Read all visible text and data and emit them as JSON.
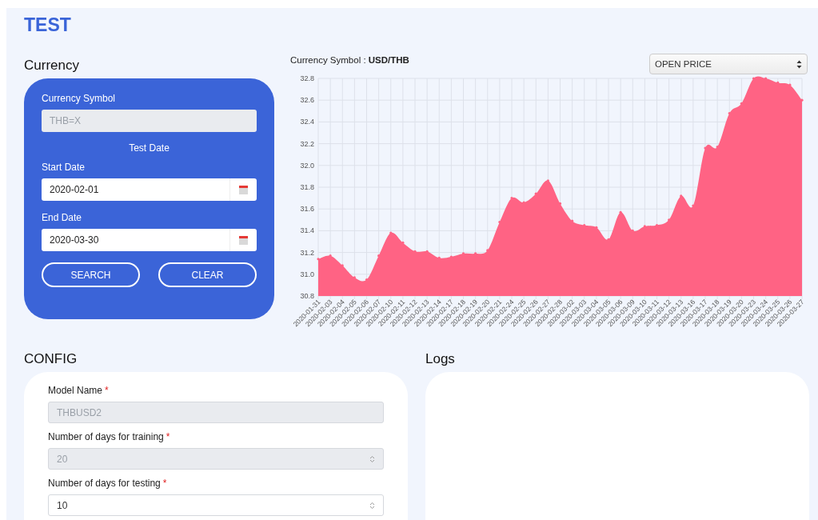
{
  "page_title": "TEST",
  "currency": {
    "heading": "Currency",
    "symbol_label": "Currency Symbol",
    "symbol": {
      "value": "THB=X",
      "disabled": true
    },
    "test_date_label": "Test Date",
    "start_label": "Start Date",
    "start_value": "2020-02-01",
    "end_label": "End Date",
    "end_value": "2020-03-30",
    "buttons": [
      "SEARCH",
      "CLEAR"
    ]
  },
  "chart_panel": {
    "symbol_text": "Currency Symbol : **USD/THB**",
    "chart_data": {
      "type": "area",
      "categories": [
        "2020-01-31",
        "2020-02-03",
        "2020-02-04",
        "2020-02-05",
        "2020-02-06",
        "2020-02-07",
        "2020-02-10",
        "2020-02-11",
        "2020-02-12",
        "2020-02-13",
        "2020-02-14",
        "2020-02-17",
        "2020-02-18",
        "2020-02-19",
        "2020-02-20",
        "2020-02-21",
        "2020-02-24",
        "2020-02-25",
        "2020-02-26",
        "2020-02-27",
        "2020-02-28",
        "2020-03-02",
        "2020-03-03",
        "2020-03-04",
        "2020-03-05",
        "2020-03-06",
        "2020-03-09",
        "2020-03-10",
        "2020-03-11",
        "2020-03-12",
        "2020-03-13",
        "2020-03-16",
        "2020-03-17",
        "2020-03-18",
        "2020-03-19",
        "2020-03-20",
        "2020-03-23",
        "2020-03-24",
        "2020-03-25",
        "2020-03-26",
        "2020-03-27"
      ],
      "grid": true,
      "series": [
        {
          "name": "OPEN PRICE",
          "color": "#ff6384",
          "values": [
            31.14,
            31.17,
            31.08,
            30.97,
            30.95,
            31.17,
            31.38,
            31.29,
            31.21,
            31.21,
            31.15,
            31.16,
            31.19,
            31.19,
            31.22,
            31.48,
            31.7,
            31.66,
            31.74,
            31.86,
            31.65,
            31.49,
            31.45,
            31.43,
            31.32,
            31.57,
            31.4,
            31.44,
            31.45,
            31.5,
            31.72,
            31.63,
            32.16,
            32.17,
            32.48,
            32.57,
            32.8,
            32.8,
            32.76,
            32.74,
            32.6
          ]
        }
      ],
      "ylim": [
        30.8,
        32.8
      ],
      "yticks": [
        {
          "value": 30.8,
          "label": "30.8"
        },
        {
          "value": 31,
          "label": "31.0"
        },
        {
          "value": 31.2,
          "label": "31.2"
        },
        {
          "value": 31.4,
          "label": "31.4"
        },
        {
          "value": 31.6,
          "label": "31.6"
        },
        {
          "value": 31.8,
          "label": "31.8"
        },
        {
          "value": 32,
          "label": "32.0"
        },
        {
          "value": 32.2,
          "label": "32.2"
        },
        {
          "value": 32.4,
          "label": "32.4"
        },
        {
          "value": 32.6,
          "label": "32.6"
        },
        {
          "value": 32.8,
          "label": "32.8"
        }
      ]
    }
  },
  "config": {
    "heading": "CONFIG",
    "required_mark": "*",
    "fields": [
      {
        "label": "Model Name",
        "required": true,
        "value": "THBUSD2",
        "kind": "text",
        "disabled": true
      },
      {
        "label": "Number of days for training",
        "required": true,
        "value": "20",
        "kind": "number",
        "disabled": true
      },
      {
        "label": "Number of days for testing",
        "required": true,
        "value": "10",
        "kind": "number",
        "disabled": false
      }
    ]
  },
  "logs": {
    "heading": "Logs"
  }
}
